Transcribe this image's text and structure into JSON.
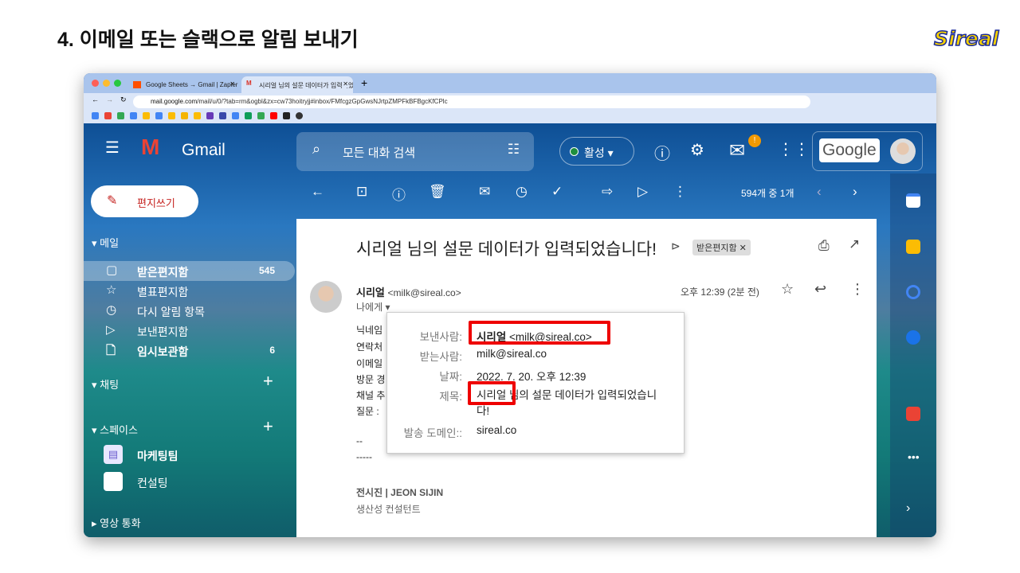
{
  "slide": {
    "title": "4. 이메일 또는 슬랙으로 알림 보내기",
    "logo": "Sireal"
  },
  "browser": {
    "tabs": [
      {
        "label": "Google Sheets → Gmail | Zapier"
      },
      {
        "label": "시리얼 님의 설문 데이터가 입력되었습니다"
      }
    ],
    "url_host": "mail.google.com",
    "url_path": "/mail/u/0/?tab=rm&ogbl&zx=cw73hoitryjj#inbox/FMfcgzGpGwsNJrtpZMPFkBFBgcKfCPlc"
  },
  "gmail": {
    "logo": "Gmail",
    "search_placeholder": "모든 대화 검색",
    "status": "활성",
    "google": "Google",
    "compose": "편지쓰기",
    "pager": "594개 중 1개",
    "sections": {
      "mail": "메일",
      "chat": "채팅",
      "spaces": "스페이스",
      "meet": "영상 통화"
    },
    "nav": [
      {
        "label": "받은편지함",
        "count": "545"
      },
      {
        "label": "별표편지함"
      },
      {
        "label": "다시 알림 항목"
      },
      {
        "label": "보낸편지함"
      },
      {
        "label": "임시보관함",
        "count": "6"
      }
    ],
    "spaces": [
      {
        "label": "마케팅팀"
      },
      {
        "label": "컨설팅"
      }
    ]
  },
  "email": {
    "subject": "시리얼 님의 설문 데이터가 입력되었습니다!",
    "label": "받은편지함",
    "sender_name": "시리얼",
    "sender_email": "<milk@sireal.co>",
    "to_me": "나에게",
    "time": "오후 12:39 (2분 전)",
    "body_lines": [
      "닉네임",
      "연락처",
      "이메일",
      "방문 경",
      "채널 추",
      "질문 : "
    ],
    "sig_dash1": "--",
    "sig_dash2": "-----",
    "sig_name": "전시진 | JEON SIJIN",
    "sig_title": "생산성 컨설턴트"
  },
  "details": {
    "from_label": "보낸사람:",
    "from_name": "시리얼",
    "from_email": "<milk@sireal.co>",
    "to_label": "받는사람:",
    "to": "milk@sireal.co",
    "date_label": "날짜:",
    "date": "2022. 7. 20. 오후 12:39",
    "subject_label": "제목:",
    "subject_line1": "시리얼 님의 설문 데이터가 입력되었습니",
    "subject_line2": "다!",
    "domain_label": "발송 도메인::",
    "domain": "sireal.co"
  }
}
